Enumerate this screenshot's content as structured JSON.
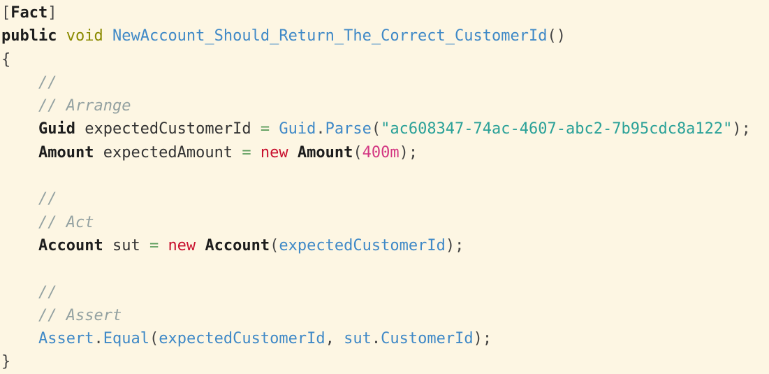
{
  "editor": {
    "lines": [
      [
        {
          "t": "[",
          "c": "pn"
        },
        {
          "t": "Fact",
          "c": "kw"
        },
        {
          "t": "]",
          "c": "pn"
        }
      ],
      [
        {
          "t": "public",
          "c": "kw"
        },
        {
          "t": " ",
          "c": "pn"
        },
        {
          "t": "void",
          "c": "ty"
        },
        {
          "t": " ",
          "c": "pn"
        },
        {
          "t": "NewAccount_Should_Return_The_Correct_CustomerId",
          "c": "fn"
        },
        {
          "t": "()",
          "c": "pn"
        }
      ],
      [
        {
          "t": "{",
          "c": "pn"
        }
      ],
      [
        {
          "t": "    ",
          "c": "pn"
        },
        {
          "t": "//",
          "c": "cm"
        }
      ],
      [
        {
          "t": "    ",
          "c": "pn"
        },
        {
          "t": "// Arrange",
          "c": "cm"
        }
      ],
      [
        {
          "t": "    ",
          "c": "pn"
        },
        {
          "t": "Guid",
          "c": "kw"
        },
        {
          "t": " expectedCustomerId ",
          "c": "id"
        },
        {
          "t": "=",
          "c": "op"
        },
        {
          "t": " ",
          "c": "pn"
        },
        {
          "t": "Guid",
          "c": "fn"
        },
        {
          "t": ".",
          "c": "pn"
        },
        {
          "t": "Parse",
          "c": "fn"
        },
        {
          "t": "(",
          "c": "pn"
        },
        {
          "t": "\"ac608347-74ac-4607-abc2-7b95cdc8a122\"",
          "c": "st"
        },
        {
          "t": ");",
          "c": "pn"
        }
      ],
      [
        {
          "t": "    ",
          "c": "pn"
        },
        {
          "t": "Amount",
          "c": "kw"
        },
        {
          "t": " expectedAmount ",
          "c": "id"
        },
        {
          "t": "=",
          "c": "op"
        },
        {
          "t": " ",
          "c": "pn"
        },
        {
          "t": "new",
          "c": "nw"
        },
        {
          "t": " ",
          "c": "pn"
        },
        {
          "t": "Amount",
          "c": "kw"
        },
        {
          "t": "(",
          "c": "pn"
        },
        {
          "t": "400m",
          "c": "nm"
        },
        {
          "t": ");",
          "c": "pn"
        }
      ],
      [],
      [
        {
          "t": "    ",
          "c": "pn"
        },
        {
          "t": "//",
          "c": "cm"
        }
      ],
      [
        {
          "t": "    ",
          "c": "pn"
        },
        {
          "t": "// Act",
          "c": "cm"
        }
      ],
      [
        {
          "t": "    ",
          "c": "pn"
        },
        {
          "t": "Account",
          "c": "kw"
        },
        {
          "t": " sut ",
          "c": "id"
        },
        {
          "t": "=",
          "c": "op"
        },
        {
          "t": " ",
          "c": "pn"
        },
        {
          "t": "new",
          "c": "nw"
        },
        {
          "t": " ",
          "c": "pn"
        },
        {
          "t": "Account",
          "c": "kw"
        },
        {
          "t": "(",
          "c": "pn"
        },
        {
          "t": "expectedCustomerId",
          "c": "fn"
        },
        {
          "t": ");",
          "c": "pn"
        }
      ],
      [],
      [
        {
          "t": "    ",
          "c": "pn"
        },
        {
          "t": "//",
          "c": "cm"
        }
      ],
      [
        {
          "t": "    ",
          "c": "pn"
        },
        {
          "t": "// Assert",
          "c": "cm"
        }
      ],
      [
        {
          "t": "    ",
          "c": "pn"
        },
        {
          "t": "Assert",
          "c": "fn"
        },
        {
          "t": ".",
          "c": "pn"
        },
        {
          "t": "Equal",
          "c": "fn"
        },
        {
          "t": "(",
          "c": "pn"
        },
        {
          "t": "expectedCustomerId",
          "c": "fn"
        },
        {
          "t": ", ",
          "c": "pn"
        },
        {
          "t": "sut",
          "c": "fn"
        },
        {
          "t": ".",
          "c": "pn"
        },
        {
          "t": "CustomerId",
          "c": "fn"
        },
        {
          "t": ");",
          "c": "pn"
        }
      ],
      [
        {
          "t": "}",
          "c": "pn"
        }
      ]
    ]
  },
  "colors": {
    "background": "#fdf6e3",
    "keyword": "#1d1d1d",
    "type": "#8a8a00",
    "identifier_blue": "#3f89c7",
    "comment": "#93a1a1",
    "operator": "#5f9f5f",
    "new_keyword": "#c8102e",
    "string": "#2aa198",
    "number": "#d33682"
  }
}
